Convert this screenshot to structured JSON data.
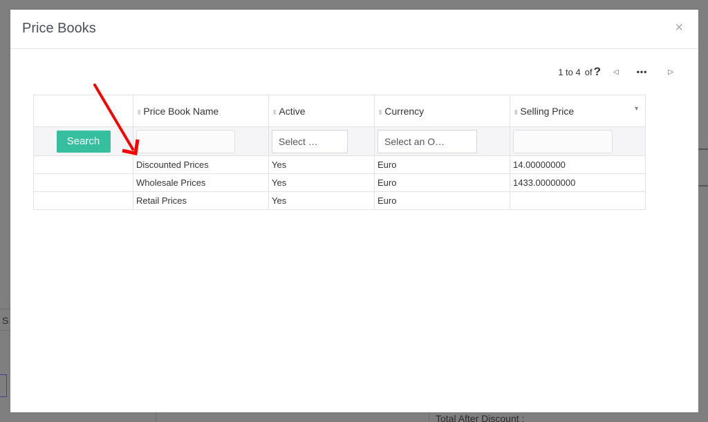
{
  "background": {
    "left_fragment": "S",
    "bottom_label": "Total After Discount :"
  },
  "modal": {
    "title": "Price Books",
    "close_icon": "×"
  },
  "pager": {
    "range": "1 to 4",
    "of_label": "of",
    "total": "?",
    "prev_icon": "◁",
    "more_icon": "•••",
    "next_icon": "▷"
  },
  "table": {
    "columns": [
      {
        "label": ""
      },
      {
        "label": "Price Book Name"
      },
      {
        "label": "Active"
      },
      {
        "label": "Currency"
      },
      {
        "label": "Selling Price"
      }
    ],
    "filters": {
      "search_label": "Search",
      "name_value": "",
      "active_placeholder": "Select …",
      "currency_placeholder": "Select an O…",
      "price_value": ""
    },
    "rows": [
      {
        "name": "Discounted Prices",
        "active": "Yes",
        "currency": "Euro",
        "selling_price": "14.00000000"
      },
      {
        "name": "Wholesale Prices",
        "active": "Yes",
        "currency": "Euro",
        "selling_price": "1433.00000000"
      },
      {
        "name": "Retail Prices",
        "active": "Yes",
        "currency": "Euro",
        "selling_price": ""
      }
    ]
  },
  "colors": {
    "accent": "#35bf9f",
    "annotation_arrow": "#ff0000",
    "overlay": "#7f7f7f"
  }
}
